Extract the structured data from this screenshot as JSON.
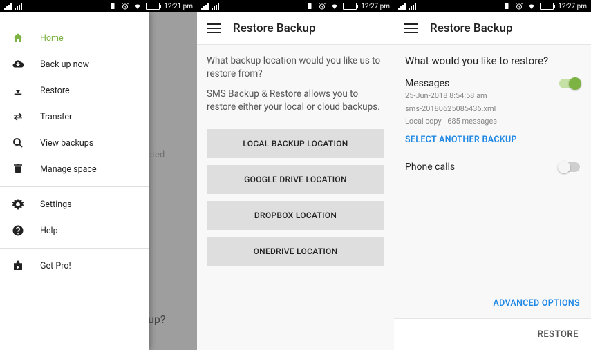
{
  "panel1": {
    "statusbar": {
      "time": "12:21 pm"
    },
    "dim_text_right": "ected",
    "dim_text_bottom": "kup?",
    "drawer": {
      "items": [
        {
          "icon": "home-icon",
          "label": "Home",
          "active": true
        },
        {
          "icon": "cloud-up-icon",
          "label": "Back up now"
        },
        {
          "icon": "download-icon",
          "label": "Restore"
        },
        {
          "icon": "transfer-icon",
          "label": "Transfer"
        },
        {
          "icon": "search-icon",
          "label": "View backups"
        },
        {
          "icon": "trash-icon",
          "label": "Manage space"
        }
      ],
      "items2": [
        {
          "icon": "gear-icon",
          "label": "Settings"
        },
        {
          "icon": "help-icon",
          "label": "Help"
        }
      ],
      "items3": [
        {
          "icon": "shop-icon",
          "label": "Get Pro!"
        }
      ]
    }
  },
  "panel2": {
    "statusbar": {
      "time": "12:27 pm"
    },
    "appbar": {
      "title": "Restore Backup"
    },
    "question": "What backup location would you like us to restore from?",
    "description": "SMS Backup & Restore allows you to restore either your local or cloud backups.",
    "buttons": [
      "LOCAL BACKUP LOCATION",
      "GOOGLE DRIVE LOCATION",
      "DROPBOX LOCATION",
      "ONEDRIVE LOCATION"
    ]
  },
  "panel3": {
    "statusbar": {
      "time": "12:27 pm"
    },
    "appbar": {
      "title": "Restore Backup"
    },
    "question": "What would you like to restore?",
    "messages": {
      "title": "Messages",
      "line1": "25-Jun-2018 8:54:58 am",
      "line2": "sms-20180625085436.xml",
      "line3": "Local copy - 685 messages",
      "link": "SELECT ANOTHER BACKUP",
      "toggle_on": true
    },
    "calls": {
      "title": "Phone calls",
      "toggle_on": false
    },
    "advanced": "ADVANCED OPTIONS",
    "footer_button": "RESTORE"
  }
}
